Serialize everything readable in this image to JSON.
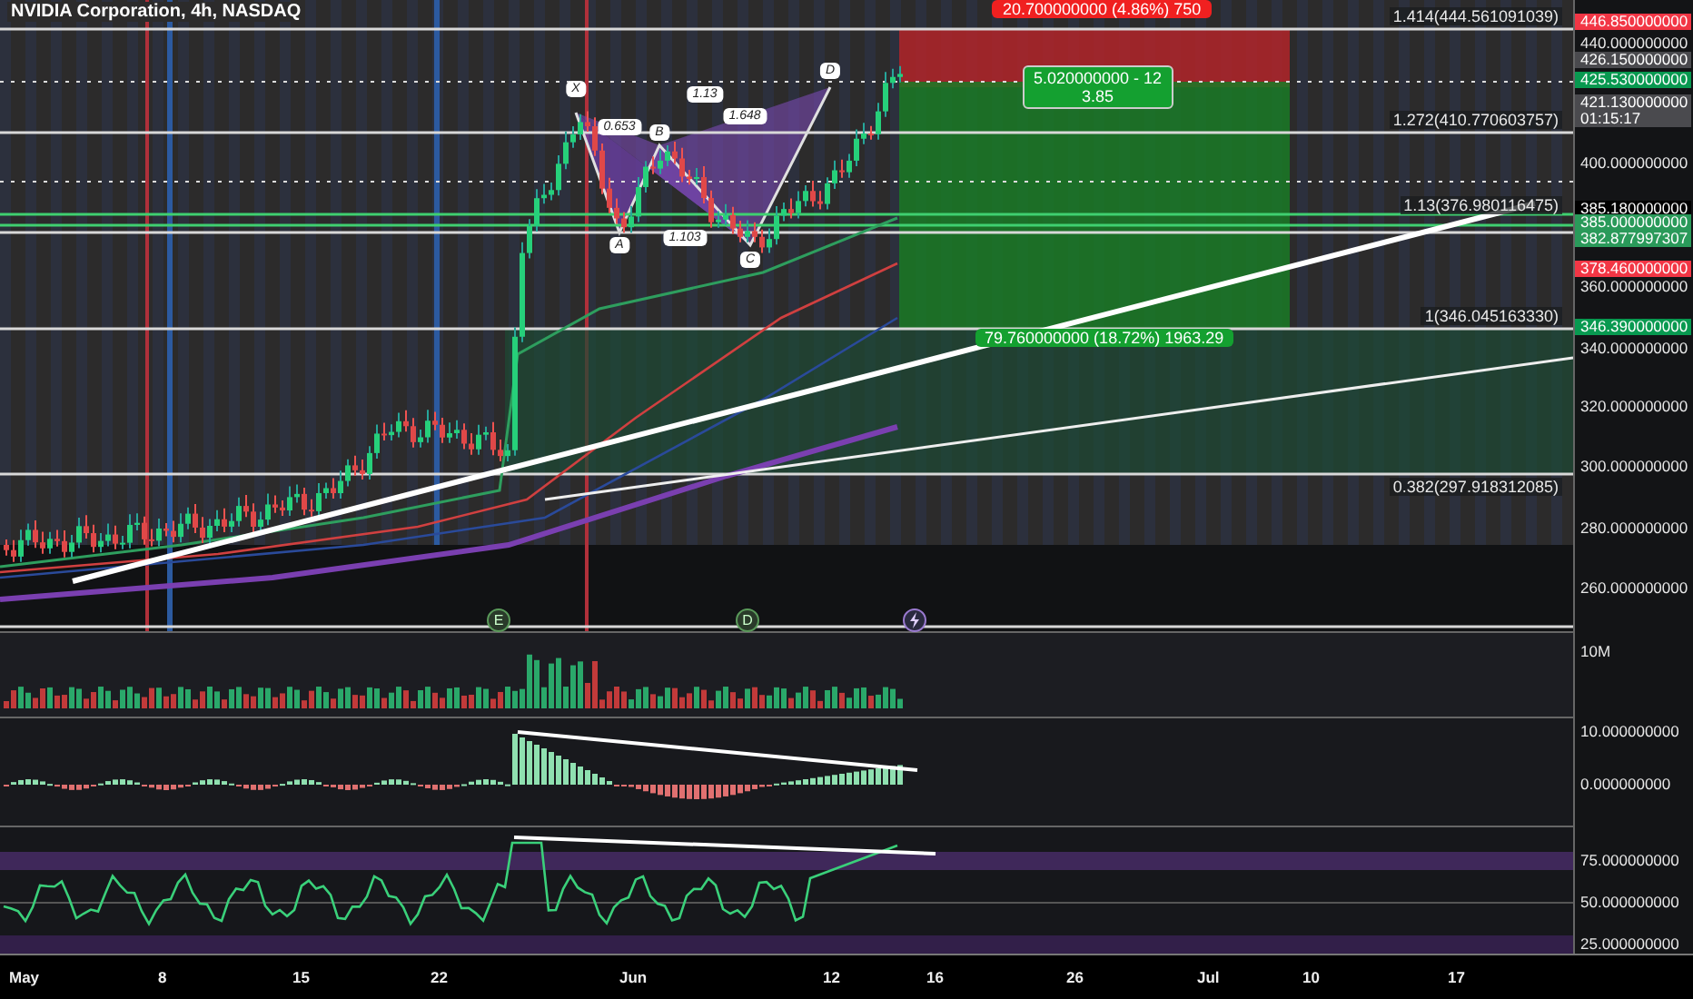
{
  "title": "NVIDIA Corporation, 4h, NASDAQ",
  "fib_levels": [
    {
      "label": "1.414(444.561091039)"
    },
    {
      "label": "1.272(410.770603757)"
    },
    {
      "label": "1.13(376.980116475)"
    },
    {
      "label": "1(346.045163330)"
    },
    {
      "label": "0.382(297.918312085)"
    }
  ],
  "pattern": {
    "points": [
      "X",
      "A",
      "B",
      "C",
      "D"
    ],
    "ratios": [
      "0.653",
      "1.13",
      "1.648",
      "1.103"
    ]
  },
  "position": {
    "stop_label": "20.700000000 (4.86%) 750",
    "center_lines": [
      "5.020000000 - 12",
      "3.85"
    ],
    "target_label": "79.760000000 (18.72%) 1963.29"
  },
  "events": [
    {
      "kind": "letter",
      "label": "E"
    },
    {
      "kind": "letter",
      "label": "D"
    },
    {
      "kind": "bolt"
    }
  ],
  "price_axis": [
    {
      "label": "446.850000000",
      "color": "#f23645"
    },
    {
      "label": "440.000000000"
    },
    {
      "label": "426.150000000",
      "color": "#4a4a4e"
    },
    {
      "label": "425.530000000",
      "color": "#089950"
    },
    {
      "label": "421.130000000",
      "sub": "01:15:17",
      "color": "#4a4a4e"
    },
    {
      "label": "400.000000000"
    },
    {
      "label": "385.180000000",
      "color": "#000000"
    },
    {
      "label": "385.000000000",
      "sub": "382.877997307",
      "color": "#2a9a5a"
    },
    {
      "label": "378.460000000",
      "color": "#f23645"
    },
    {
      "label": "360.000000000"
    },
    {
      "label": "346.390000000",
      "color": "#089950"
    },
    {
      "label": "340.000000000"
    },
    {
      "label": "320.000000000"
    },
    {
      "label": "300.000000000"
    },
    {
      "label": "280.000000000"
    },
    {
      "label": "260.000000000"
    }
  ],
  "volume_axis": [
    "10M"
  ],
  "macd_axis": [
    "10.000000000",
    "0.000000000"
  ],
  "rsi_axis": [
    "75.000000000",
    "50.000000000",
    "25.000000000"
  ],
  "time_axis": [
    "May",
    "8",
    "15",
    "22",
    "Jun",
    "12",
    "16",
    "26",
    "Jul",
    "10",
    "17"
  ]
}
